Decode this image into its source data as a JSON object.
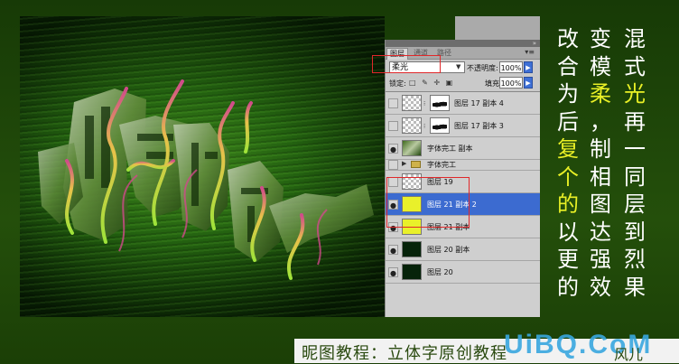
{
  "panel": {
    "tabs": [
      {
        "label": "图层",
        "active": true
      },
      {
        "label": "通道",
        "active": false
      },
      {
        "label": "路径",
        "active": false
      }
    ],
    "blend_mode": "柔光",
    "opacity_label": "不透明度:",
    "opacity_value": "100%",
    "lock_label": "锁定:",
    "fill_label": "填充:",
    "fill_value": "100%",
    "layers": [
      {
        "name": "图层 17 副本 4",
        "visible": false,
        "thumb": "transparent",
        "mask": true
      },
      {
        "name": "图层 17 副本 3",
        "visible": false,
        "thumb": "transparent",
        "mask": true
      },
      {
        "name": "字体完工 副本",
        "visible": true,
        "thumb": "artwork",
        "mask": false
      },
      {
        "name": "字体完工",
        "visible": false,
        "group": true
      },
      {
        "name": "图层 19",
        "visible": false,
        "thumb": "transparent",
        "mask": false
      },
      {
        "name": "图层 21 副本 2",
        "visible": true,
        "thumb": "yellow",
        "mask": false,
        "selected": true
      },
      {
        "name": "图层 21 副本",
        "visible": true,
        "thumb": "yellow",
        "mask": false
      },
      {
        "name": "图层 20 副本",
        "visible": true,
        "thumb": "dark",
        "mask": false
      },
      {
        "name": "图层 20",
        "visible": true,
        "thumb": "dark",
        "mask": false
      }
    ]
  },
  "poem": {
    "col_right": [
      "混",
      "式",
      "光",
      "再",
      "一",
      "同",
      "层",
      "到",
      "烈",
      "果"
    ],
    "col_middle": [
      "变",
      "模",
      "柔",
      "，",
      "制",
      "相",
      "图",
      "达",
      "强",
      "效"
    ],
    "col_left": [
      "改",
      "合",
      "为",
      "后",
      "复",
      "个",
      "的",
      "以",
      "更",
      "的"
    ],
    "highlight_color": "#e9f026",
    "text_color": "#ffffff"
  },
  "caption": {
    "text": "昵图教程：立体字原创教程",
    "brand": "UiBQ.CoM",
    "author": "风儿"
  },
  "colors": {
    "background": "#1b3f06",
    "selected_layer": "#3c6bd0",
    "highlight_box": "#e0282a"
  }
}
